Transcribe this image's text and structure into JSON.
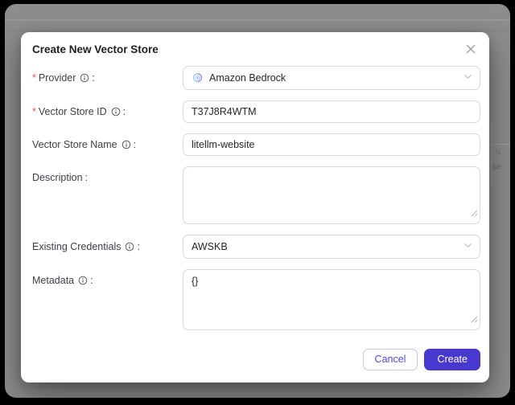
{
  "background": {
    "sort_icon": "↑↓",
    "partial_text": "se"
  },
  "modal": {
    "title": "Create New Vector Store",
    "required_mark": "*",
    "colon": ":",
    "fields": [
      {
        "name": "provider",
        "label": "Provider",
        "required": true,
        "has_info": true,
        "type": "select",
        "value": "Amazon Bedrock",
        "icon": "amazon-bedrock-logo"
      },
      {
        "name": "vector_store_id",
        "label": "Vector Store ID",
        "required": true,
        "has_info": true,
        "type": "input",
        "value": "T37J8R4WTM"
      },
      {
        "name": "vector_store_name",
        "label": "Vector Store Name",
        "required": false,
        "has_info": true,
        "type": "input",
        "value": "litellm-website"
      },
      {
        "name": "description",
        "label": "Description",
        "required": false,
        "has_info": false,
        "type": "textarea",
        "value": ""
      },
      {
        "name": "existing_credentials",
        "label": "Existing Credentials",
        "required": false,
        "has_info": true,
        "type": "select",
        "value": "AWSKB"
      },
      {
        "name": "metadata",
        "label": "Metadata",
        "required": false,
        "has_info": true,
        "type": "textarea",
        "value": "{}"
      }
    ],
    "footer": {
      "cancel_label": "Cancel",
      "create_label": "Create"
    }
  },
  "icons": {
    "close": "×",
    "chevron_down": "chevron-down",
    "info": "circled-i",
    "sort": "↑↓"
  },
  "colors": {
    "accent": "#4838cf",
    "cancel_text": "#4f46e5",
    "cancel_border": "#c9c4f0",
    "required_mark": "#ff4d4f",
    "input_border": "#d9d9d9",
    "overlay": "#8d8d8d",
    "modal_bg": "#ffffff"
  }
}
